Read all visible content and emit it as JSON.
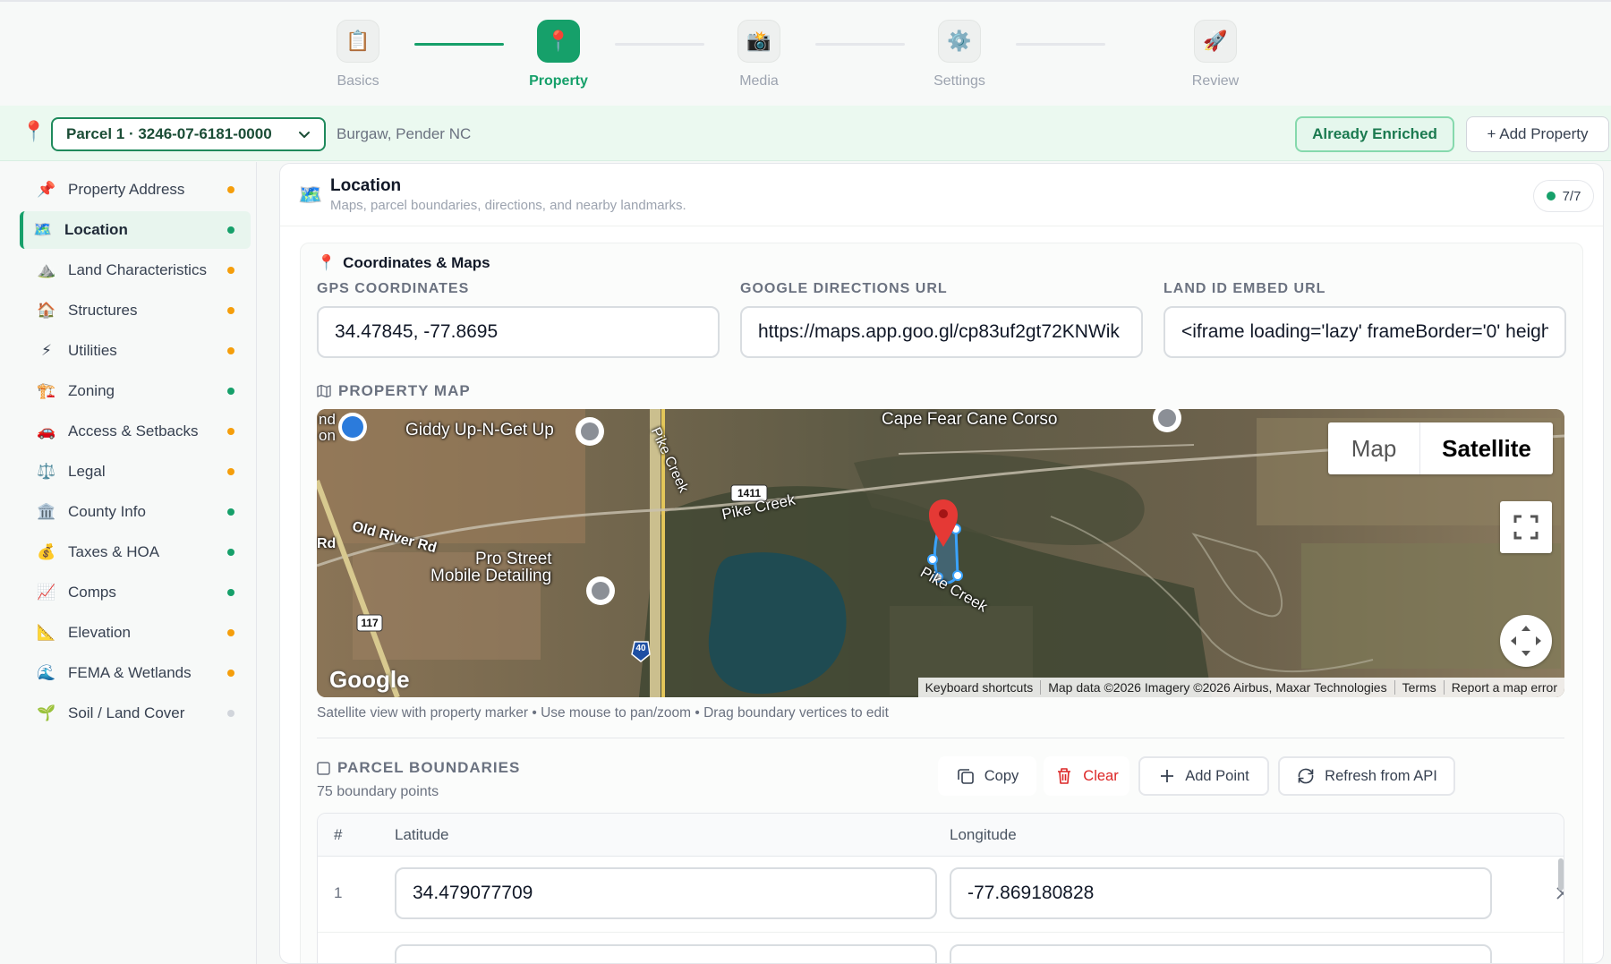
{
  "stepper": {
    "steps": [
      {
        "label": "Basics",
        "icon": "📋"
      },
      {
        "label": "Property",
        "icon": "📍"
      },
      {
        "label": "Media",
        "icon": "📸"
      },
      {
        "label": "Settings",
        "icon": "⚙️"
      },
      {
        "label": "Review",
        "icon": "🚀"
      }
    ],
    "active_index": 1,
    "colors": {
      "active": "#16a06a",
      "inactive": "#9ca3af"
    }
  },
  "parcel_bar": {
    "pin_icon": "📍",
    "selected_parcel": "Parcel 1 · 3246-07-6181-0000",
    "location": "Burgaw, Pender NC",
    "enriched_label": "Already Enriched",
    "add_property_label": "+ Add Property"
  },
  "sidebar": {
    "items": [
      {
        "label": "Property Address",
        "icon": "📌",
        "status": "orange"
      },
      {
        "label": "Location",
        "icon": "🗺️",
        "status": "green",
        "active": true
      },
      {
        "label": "Land Characteristics",
        "icon": "⛰️",
        "status": "orange"
      },
      {
        "label": "Structures",
        "icon": "🏠",
        "status": "orange"
      },
      {
        "label": "Utilities",
        "icon": "⚡",
        "status": "orange"
      },
      {
        "label": "Zoning",
        "icon": "🏗️",
        "status": "green"
      },
      {
        "label": "Access & Setbacks",
        "icon": "🚗",
        "status": "orange"
      },
      {
        "label": "Legal",
        "icon": "⚖️",
        "status": "orange"
      },
      {
        "label": "County Info",
        "icon": "🏛️",
        "status": "green"
      },
      {
        "label": "Taxes & HOA",
        "icon": "💰",
        "status": "green"
      },
      {
        "label": "Comps",
        "icon": "📈",
        "status": "green"
      },
      {
        "label": "Elevation",
        "icon": "📐",
        "status": "orange"
      },
      {
        "label": "FEMA & Wetlands",
        "icon": "🌊",
        "status": "orange"
      },
      {
        "label": "Soil / Land Cover",
        "icon": "🌱",
        "status": "gray"
      }
    ],
    "status_colors": {
      "orange": "#f59e0b",
      "green": "#16a06a",
      "gray": "#d1d5db"
    }
  },
  "main": {
    "icon": "🗺️",
    "title": "Location",
    "subtitle": "Maps, parcel boundaries, directions, and nearby landmarks.",
    "progress": "7/7",
    "section": {
      "title": "Coordinates & Maps",
      "fields": [
        {
          "label": "GPS COORDINATES",
          "value": "34.47845, -77.8695"
        },
        {
          "label": "GOOGLE DIRECTIONS URL",
          "value": "https://maps.app.goo.gl/cp83uf2gt72KNWik"
        },
        {
          "label": "LAND ID EMBED URL",
          "value": "<iframe loading='lazy' frameBorder='0' height"
        }
      ],
      "map": {
        "label": "PROPERTY MAP",
        "type_map": "Map",
        "type_satellite": "Satellite",
        "places": [
          "Giddy Up-N-Get Up",
          "Cape Fear Cane Corso",
          "Pro Street",
          "Mobile Detailing",
          "nd",
          "on"
        ],
        "roads": [
          "Pike Creek",
          "Pike Creek",
          "Pike Creek",
          "Old River Rd",
          "Rd"
        ],
        "shields": [
          "1411",
          "117",
          "40"
        ],
        "logo": "Google",
        "footer": [
          "Keyboard shortcuts",
          "Map data ©2026 Imagery ©2026 Airbus, Maxar Technologies",
          "Terms",
          "Report a map error"
        ],
        "caption": "Satellite view with property marker • Use mouse to pan/zoom • Drag boundary vertices to edit"
      },
      "boundaries": {
        "label": "PARCEL BOUNDARIES",
        "count_text": "75 boundary points",
        "buttons": {
          "copy": "Copy",
          "clear": "Clear",
          "add_point": "Add Point",
          "refresh": "Refresh from API"
        },
        "columns": [
          "#",
          "Latitude",
          "Longitude"
        ],
        "rows": [
          {
            "num": "1",
            "lat": "34.479077709",
            "lng": "-77.869180828"
          },
          {
            "num": "",
            "lat": "",
            "lng": ""
          }
        ]
      }
    }
  }
}
